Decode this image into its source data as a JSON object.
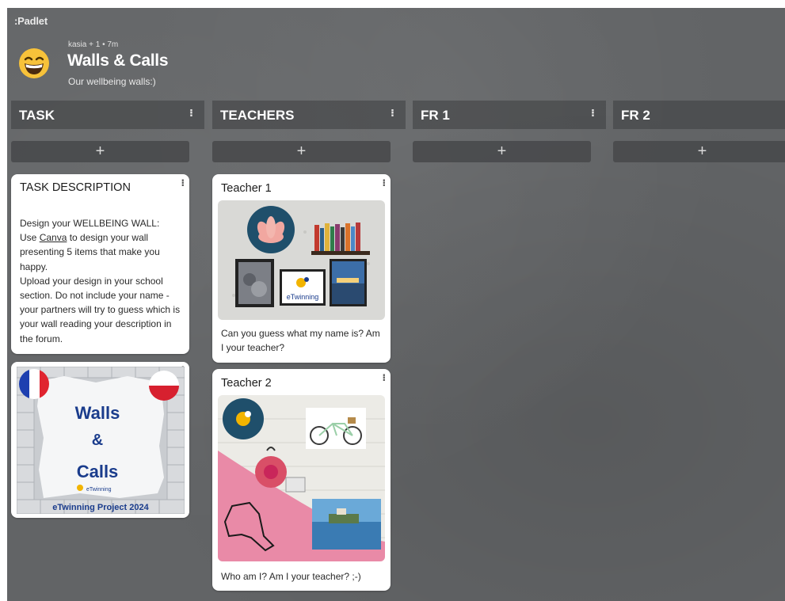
{
  "header": {
    "brand": ":Padlet",
    "meta": "kasia + 1 • 7m",
    "title": "Walls & Calls",
    "subtitle": "Our wellbeing walls:)",
    "emoji_icon": "grinning-face-icon"
  },
  "menu_glyph": "⁝",
  "add_glyph": "+",
  "sections": [
    {
      "title": "TASK"
    },
    {
      "title": "TEACHERS"
    },
    {
      "title": "FR 1"
    },
    {
      "title": "FR 2"
    }
  ],
  "posts": {
    "task_description": {
      "title": "TASK DESCRIPTION",
      "line1": "Design your WELLBEING WALL:",
      "use_text": "Use ",
      "link_text": "Canva",
      "line2_rest": " to design your wall presenting 5 items that make you happy.",
      "line3": "Upload your design in your school section. Do not include your name - your partners will try to guess which is your wall reading your description in the forum."
    },
    "project_logo": {
      "line_walls": "Walls",
      "line_amp": "&",
      "line_calls": "Calls",
      "etwinning_small": "eTwinning",
      "footer": "eTwinning Project 2024"
    },
    "teacher1": {
      "title": "Teacher 1",
      "image_label": "eTwinning",
      "caption": "Can you guess what my name is? Am I your teacher?"
    },
    "teacher2": {
      "title": "Teacher 2",
      "caption": "Who am I? Am I your teacher? ;-)"
    }
  },
  "colors": {
    "board_bg": "#626466",
    "card_bg": "#ffffff",
    "logo_blue": "#1a3c8c",
    "emoji_yellow": "#f7c23a"
  }
}
